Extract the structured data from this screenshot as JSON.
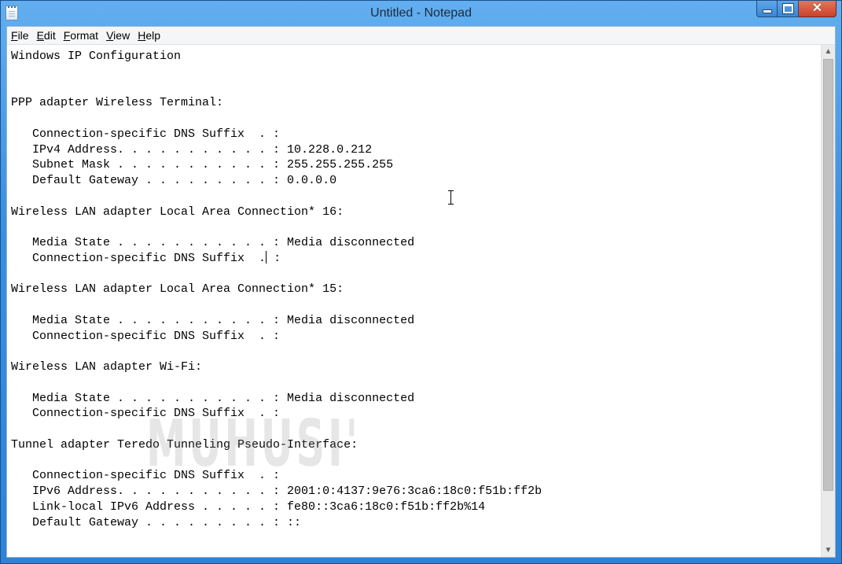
{
  "window": {
    "title": "Untitled - Notepad",
    "icon": "notepad-icon"
  },
  "menu": [
    {
      "label_first": "F",
      "label_rest": "ile"
    },
    {
      "label_first": "E",
      "label_rest": "dit"
    },
    {
      "label_first": "F",
      "label_rest": "ormat"
    },
    {
      "label_first": "V",
      "label_rest": "iew"
    },
    {
      "label_first": "H",
      "label_rest": "elp"
    }
  ],
  "document": {
    "line_01": "Windows IP Configuration",
    "line_04": "PPP adapter Wireless Terminal:",
    "line_06": "   Connection-specific DNS Suffix  . :",
    "line_07": "   IPv4 Address. . . . . . . . . . . : 10.228.0.212",
    "line_08": "   Subnet Mask . . . . . . . . . . . : 255.255.255.255",
    "line_09": "   Default Gateway . . . . . . . . . : 0.0.0.0",
    "line_11": "Wireless LAN adapter Local Area Connection* 16:",
    "line_13": "   Media State . . . . . . . . . . . : Media disconnected",
    "line_14_pre": "   Connection-specific DNS Suffix  .",
    "line_14_post": " :",
    "line_16": "Wireless LAN adapter Local Area Connection* 15:",
    "line_18": "   Media State . . . . . . . . . . . : Media disconnected",
    "line_19": "   Connection-specific DNS Suffix  . :",
    "line_21": "Wireless LAN adapter Wi-Fi:",
    "line_23": "   Media State . . . . . . . . . . . : Media disconnected",
    "line_24": "   Connection-specific DNS Suffix  . :",
    "line_26": "Tunnel adapter Teredo Tunneling Pseudo-Interface:",
    "line_28": "   Connection-specific DNS Suffix  . :",
    "line_29": "   IPv6 Address. . . . . . . . . . . : 2001:0:4137:9e76:3ca6:18c0:f51b:ff2b",
    "line_30": "   Link-local IPv6 Address . . . . . : fe80::3ca6:18c0:f51b:ff2b%14",
    "line_31": "   Default Gateway . . . . . . . . . : ::"
  },
  "watermark": "MUHUSI'S BLOG",
  "colors": {
    "titlebar": "#3b8fdf",
    "close_button": "#c7432a"
  }
}
